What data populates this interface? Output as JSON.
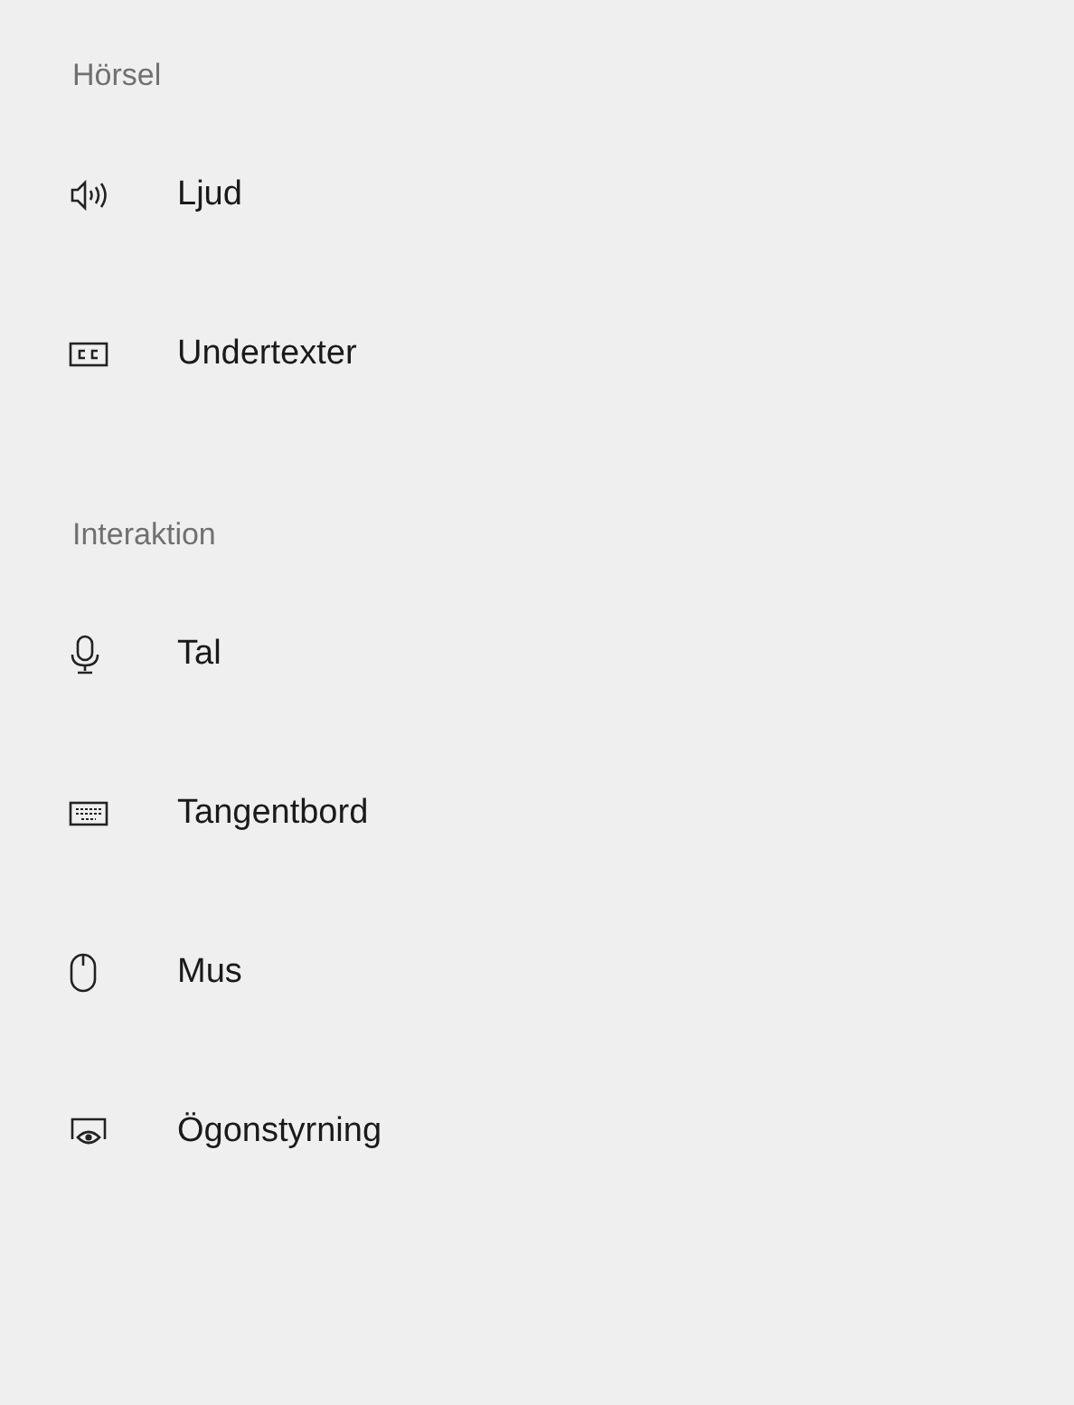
{
  "sections": [
    {
      "title": "Hörsel",
      "items": [
        {
          "kind": "speaker",
          "label": "Ljud"
        },
        {
          "kind": "captions",
          "label": "Undertexter"
        }
      ]
    },
    {
      "title": "Interaktion",
      "items": [
        {
          "kind": "microphone",
          "label": "Tal"
        },
        {
          "kind": "keyboard",
          "label": "Tangentbord"
        },
        {
          "kind": "mouse",
          "label": "Mus"
        },
        {
          "kind": "eye-control",
          "label": "Ögonstyrning"
        }
      ]
    }
  ]
}
